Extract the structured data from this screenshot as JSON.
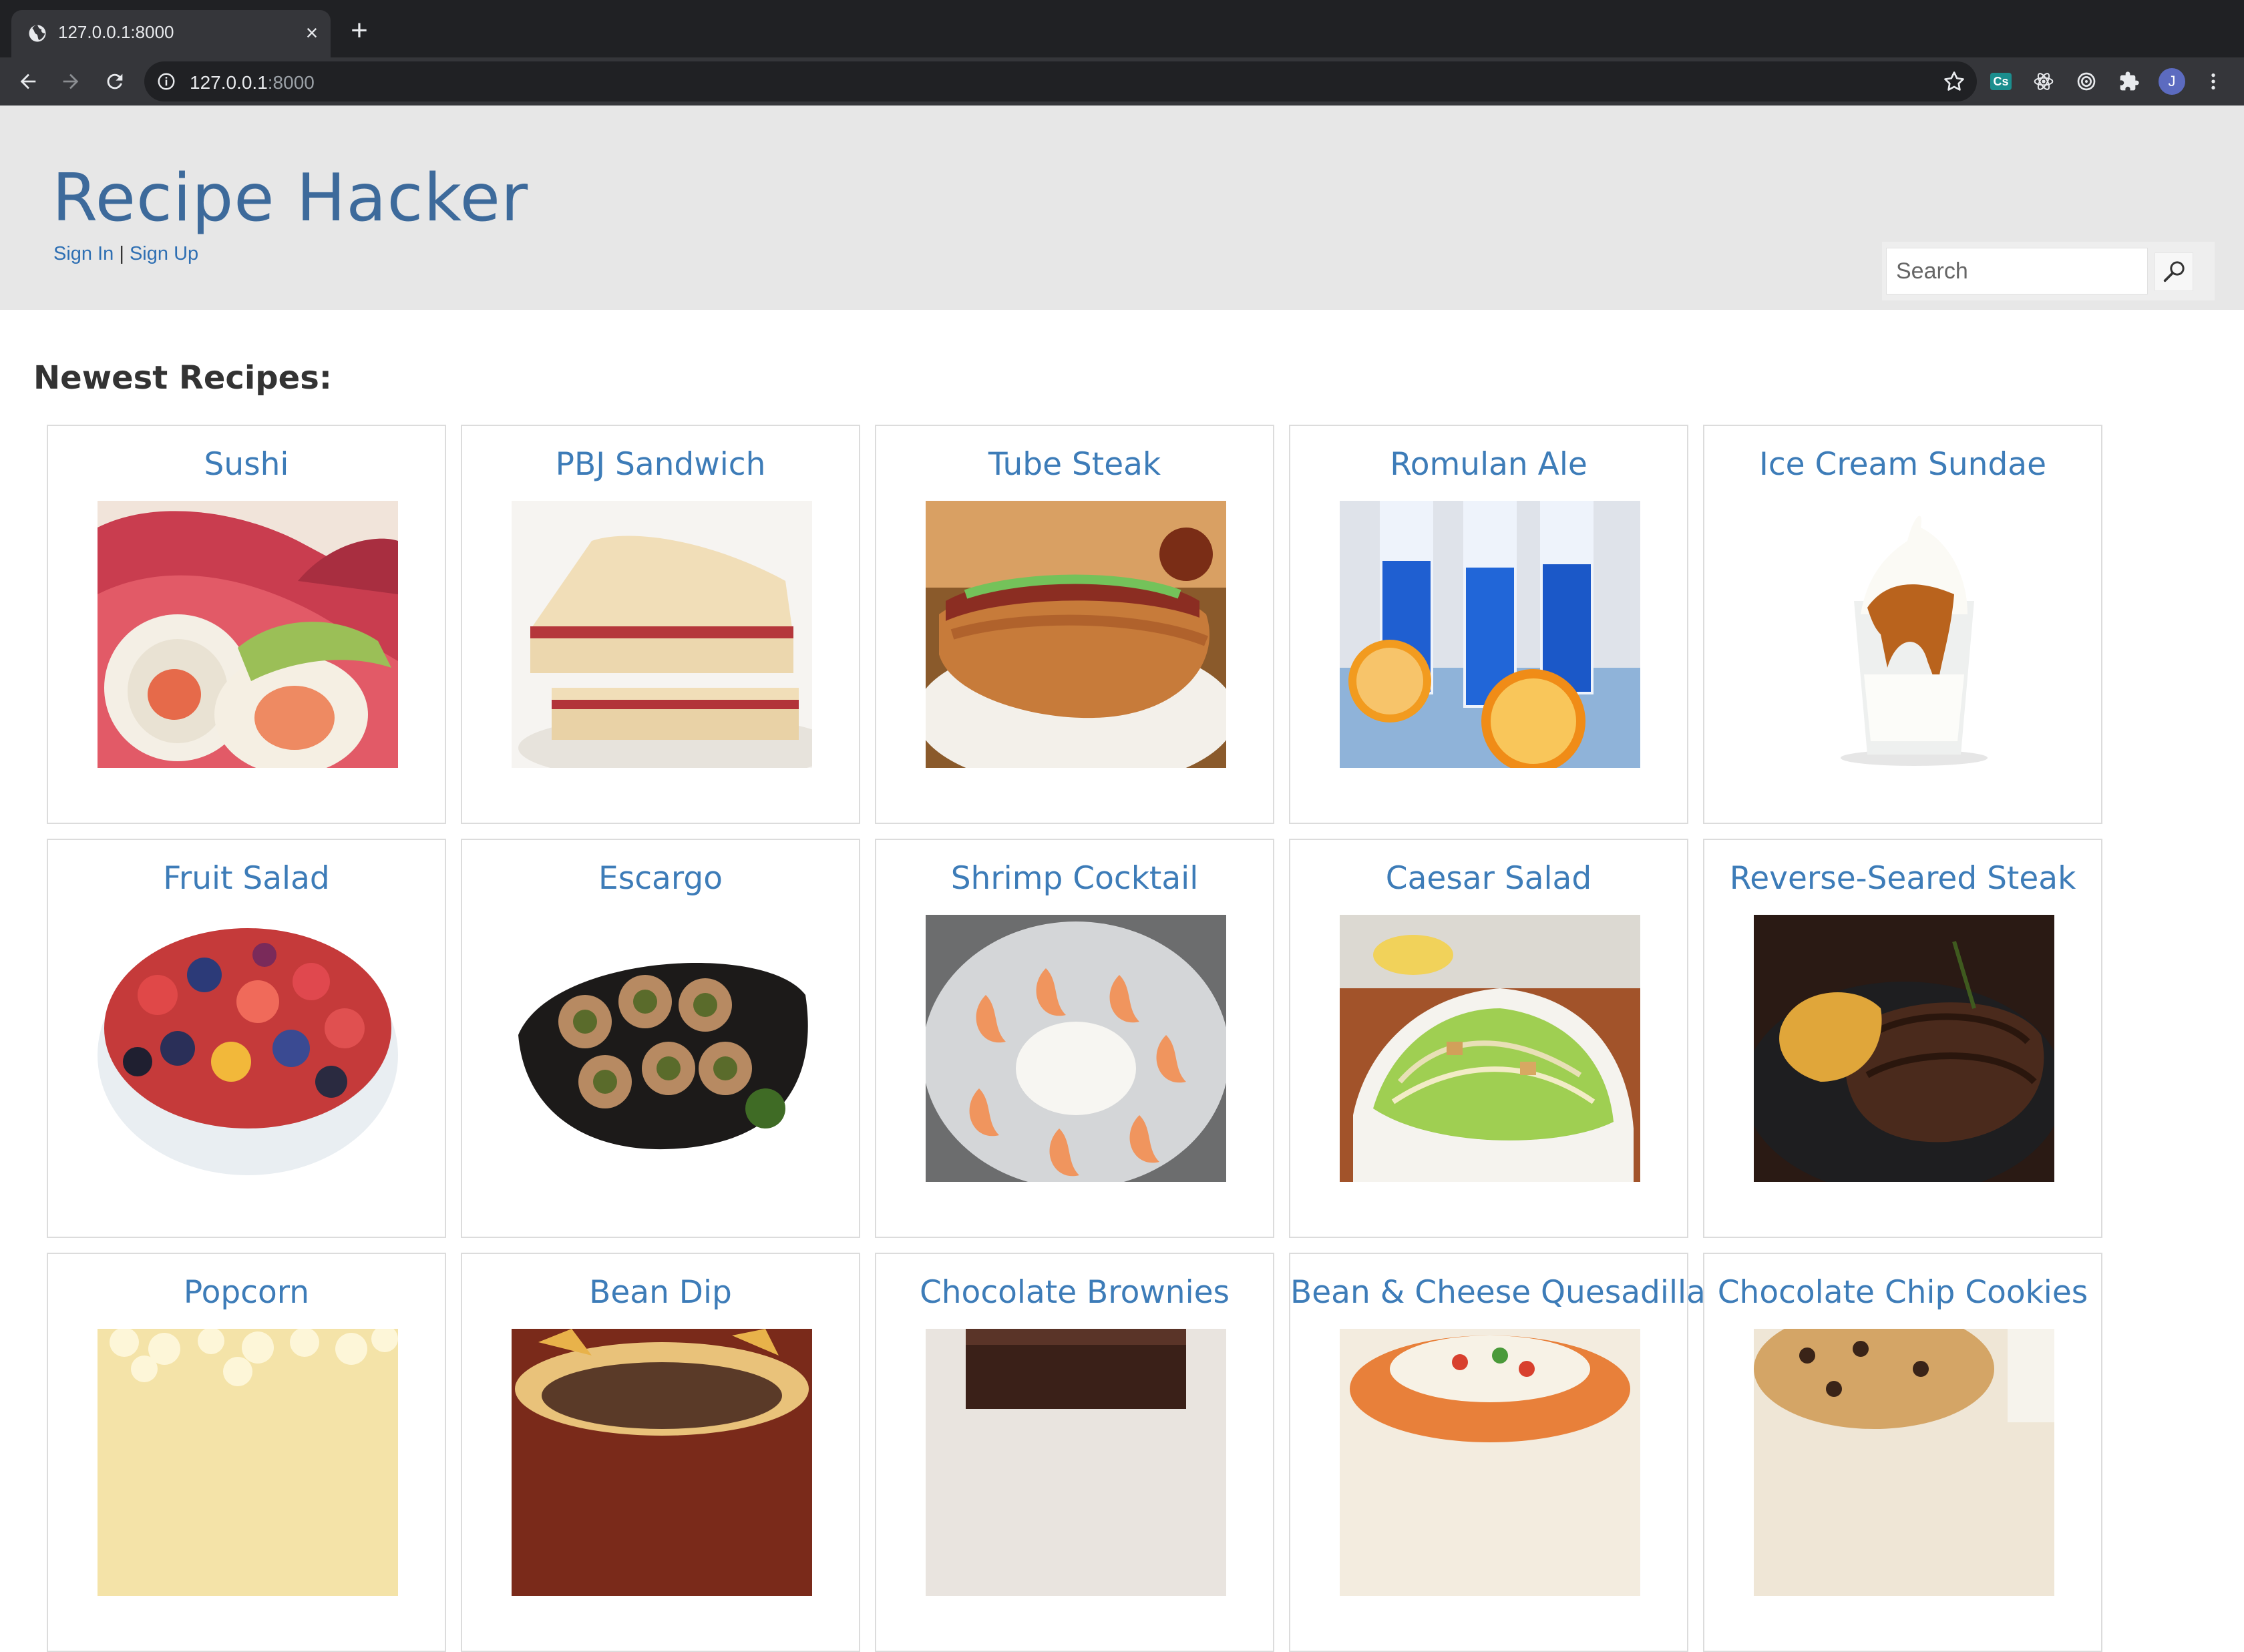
{
  "browser": {
    "tab_title": "127.0.0.1:8000",
    "url_host": "127.0.0.1",
    "url_port": ":8000",
    "avatar_letter": "J",
    "extension_label": "Cs"
  },
  "site": {
    "title": "Recipe Hacker",
    "sign_in": "Sign In",
    "separator": "|",
    "sign_up": "Sign Up",
    "search_placeholder": "Search"
  },
  "main": {
    "section_title": "Newest Recipes:",
    "recipes": [
      {
        "name": "Sushi",
        "image": "sushi roll"
      },
      {
        "name": "PBJ Sandwich",
        "image": "sandwich"
      },
      {
        "name": "Tube Steak",
        "image": "hot dog"
      },
      {
        "name": "Romulan Ale",
        "image": "blue drinks"
      },
      {
        "name": "Ice Cream Sundae",
        "image": "sundae"
      },
      {
        "name": "Fruit Salad",
        "image": "fruit salad"
      },
      {
        "name": "Escargo",
        "image": "snails"
      },
      {
        "name": "Shrimp Cocktail",
        "image": "shrimp"
      },
      {
        "name": "Caesar Salad",
        "image": "salad"
      },
      {
        "name": "Reverse-Seared Steak",
        "image": "steak"
      },
      {
        "name": "Popcorn",
        "image": "popcorn"
      },
      {
        "name": "Bean Dip",
        "image": "bean dip"
      },
      {
        "name": "Chocolate Brownies",
        "image": "brownies"
      },
      {
        "name": "Bean & Cheese Quesadilla",
        "image": "quesadilla"
      },
      {
        "name": "Chocolate Chip Cookies",
        "image": "cookies"
      }
    ]
  }
}
